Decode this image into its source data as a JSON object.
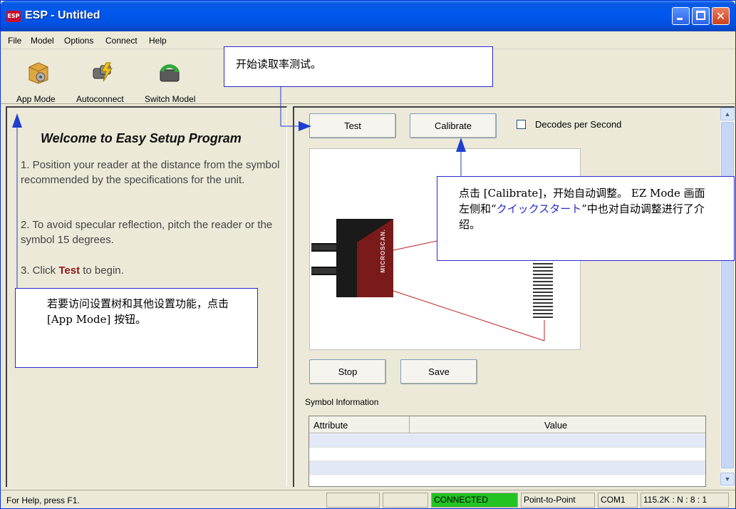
{
  "window": {
    "app_icon": "ESP",
    "title": "ESP - Untitled",
    "controls": [
      "minimize-icon",
      "maximize-icon",
      "close-icon"
    ]
  },
  "menu": [
    "File",
    "Model",
    "Options",
    "Connect",
    "Help"
  ],
  "toolbar": {
    "app_mode": "App Mode",
    "autoconnect": "Autoconnect",
    "switch_model": "Switch Model"
  },
  "welcome": {
    "title": "Welcome to Easy Setup Program",
    "step1": "1. Position your reader at the distance from the symbol recommended by the specifications for the unit.",
    "step2": "2. To avoid specular reflection, pitch the reader or the symbol 15 degrees.",
    "step3_prefix": "3. Click ",
    "step3_bold": "Test",
    "step3_suffix": " to begin."
  },
  "controls": {
    "test": "Test",
    "calibrate": "Calibrate",
    "decodes_label": "Decodes per Second",
    "decodes_checked": false,
    "stop": "Stop",
    "save": "Save"
  },
  "diagram": {
    "scanner_brand": "MICROSCAN."
  },
  "symbol_info": {
    "label": "Symbol Information",
    "columns": [
      "Attribute",
      "Value"
    ],
    "rows": [
      [
        "",
        ""
      ],
      [
        "",
        ""
      ],
      [
        "",
        ""
      ],
      [
        "",
        ""
      ]
    ]
  },
  "status": {
    "help": "For Help, press F1.",
    "connected": "CONNECTED",
    "mode": "Point-to-Point",
    "port": "COM1",
    "settings": "115.2K : N : 8 : 1",
    "connected_color": "#22c322"
  },
  "callouts": {
    "test_note": "开始读取率测试。",
    "calibrate_note_1": "点击 [Calibrate]，开始自动调整。 EZ Mode 画面左侧和“",
    "calibrate_note_link": "クイックスタート",
    "calibrate_note_2": "”中也对自动调整进行了介绍。",
    "appmode_note": "若要访问设置树和其他设置功能，点击 [App Mode] 按钮。",
    "link_color": "#2a2ad0"
  }
}
